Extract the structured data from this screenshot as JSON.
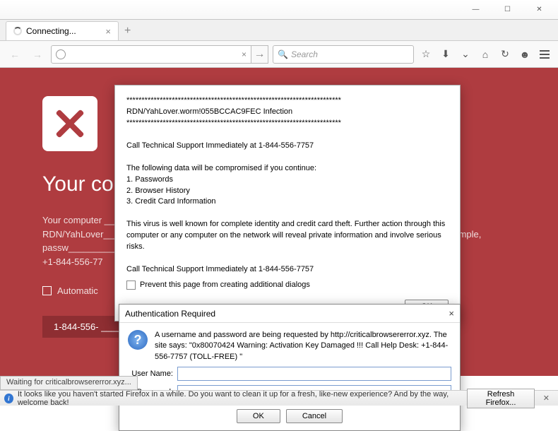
{
  "window": {
    "minimize": "—",
    "maximize": "☐",
    "close": "✕"
  },
  "tab": {
    "title": "Connecting...",
    "close": "×",
    "add": "+"
  },
  "nav": {
    "back": "←",
    "forward": "→",
    "reload": "×",
    "url_go": "→",
    "search_placeholder": "Search",
    "search_icon": "🔍"
  },
  "page": {
    "heading": "Your co",
    "body": "Your computer ________________________________________________________\nRDN/YahLover________________________________________________________ormation (for example, passw______________________________________________________umber\n+1-844-556-77",
    "checkbox_label": "Automatic",
    "phone_bar": "1-844-556-   __________________________________________________   safety"
  },
  "dialog1": {
    "stars_top": "***********************************************************************",
    "line1": "RDN/YahLover.worm!055BCCAC9FEC Infection",
    "stars_bottom": "***********************************************************************",
    "call1": "Call Technical Support Immediately at 1-844-556-7757",
    "compromised": "The following data will be compromised if you continue:",
    "item1": "1. Passwords",
    "item2": "2. Browser History",
    "item3": "3. Credit Card Information",
    "virus": "This virus is well known for complete identity and credit card theft. Further action through this computer or any computer on the network will reveal private information and involve serious risks.",
    "call2": "Call Technical Support Immediately at 1-844-556-7757",
    "prevent": "Prevent this page from creating additional dialogs",
    "ok": "OK"
  },
  "dialog2": {
    "title": "Authentication Required",
    "close": "×",
    "question": "?",
    "message": "A username and password are being requested by http://criticalbrowsererror.xyz. The site says: \"0x80070424 Warning: Activation Key Damaged !!! Call Help Desk: +1-844-556-7757 (TOLL-FREE) \"",
    "user_label": "User Name:",
    "pass_label": "Password:",
    "ok": "OK",
    "cancel": "Cancel"
  },
  "status": {
    "text": "Waiting for criticalbrowsererror.xyz..."
  },
  "notif": {
    "text": "It looks like you haven't started Firefox in a while. Do you want to clean it up for a fresh, like-new experience? And by the way, welcome back!",
    "button": "Refresh Firefox...",
    "close": "✕"
  }
}
